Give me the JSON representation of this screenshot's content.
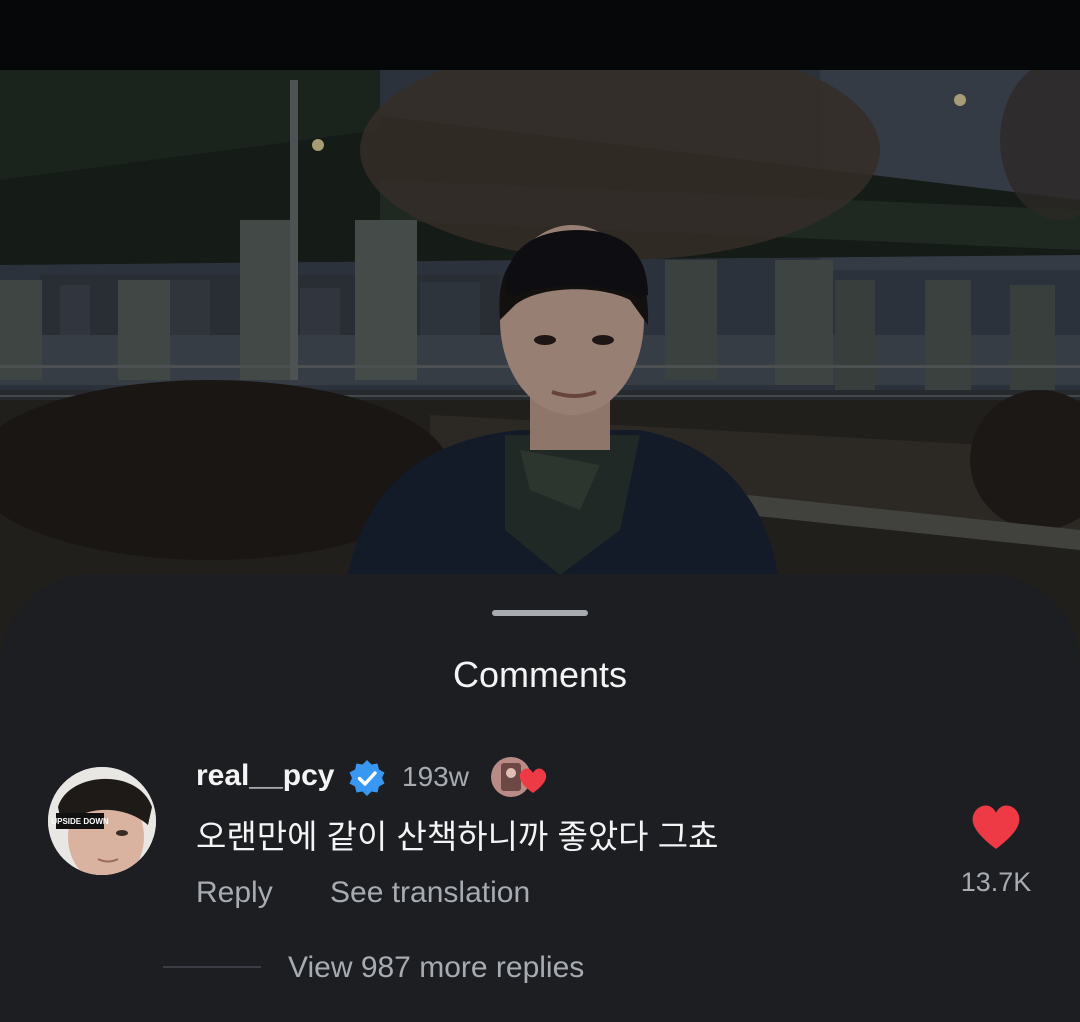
{
  "sheet": {
    "title": "Comments"
  },
  "comment": {
    "username": "real__pcy",
    "verified": true,
    "time": "193w",
    "text": "오랜만에 같이 산책하니까 좋았다 그쵸",
    "reply_label": "Reply",
    "translate_label": "See translation",
    "like_count": "13.7K",
    "liked": true,
    "liked_by_creator": true,
    "avatar_sticker_text": "UPSIDE DOWN",
    "view_replies_label": "View 987 more replies"
  },
  "icons": {
    "verified": "verified-badge-icon",
    "like": "heart-icon",
    "creator_like": "creator-liked-heart-icon"
  },
  "colors": {
    "sheet_bg": "#1c1e22",
    "heart": "#ee3a45",
    "verified": "#3897f0",
    "secondary_text": "#a7abb2"
  }
}
